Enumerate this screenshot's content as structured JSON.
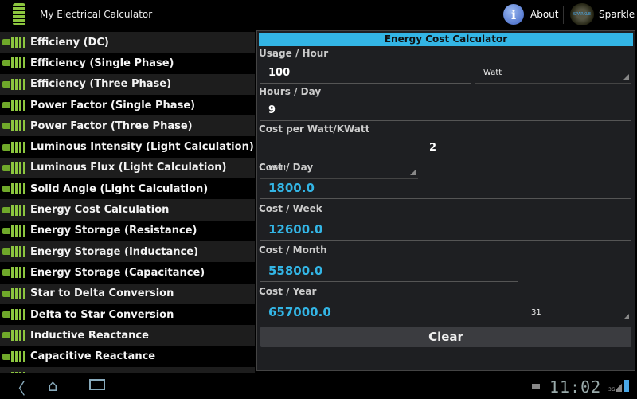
{
  "app": {
    "title": "My Electrical Calculator",
    "about": "About",
    "sparkle": "Sparkle",
    "sparkle_logo_text": "SPARKLE"
  },
  "sidebar": {
    "items": [
      "Efficieny (DC)",
      "Efficiency (Single Phase)",
      "Efficiency (Three Phase)",
      "Power Factor (Single Phase)",
      "Power Factor (Three Phase)",
      "Luminous Intensity (Light Calculation)",
      "Luminous Flux (Light Calculation)",
      "Solid Angle (Light Calculation)",
      "Energy Cost Calculation",
      "Energy Storage (Resistance)",
      "Energy Storage (Inductance)",
      "Energy Storage (Capacitance)",
      "Star to Delta Conversion",
      "Delta to Star Conversion",
      "Inductive Reactance",
      "Capacitive Reactance",
      ""
    ]
  },
  "calc": {
    "title": "Energy Cost Calculator",
    "usage_label": "Usage / Hour",
    "usage_value": "100",
    "usage_unit": "Watt",
    "hours_label": "Hours / Day",
    "hours_value": "9",
    "cost_label": "Cost per Watt/KWatt",
    "cost_unit": "Watt",
    "cost_value": "2",
    "day_label": "Cost / Day",
    "day_value": "1800.0",
    "week_label": "Cost / Week",
    "week_value": "12600.0",
    "month_label": "Cost / Month",
    "month_value": "55800.0",
    "month_days": "31",
    "year_label": "Cost / Year",
    "year_value": "657000.0",
    "clear": "Clear"
  },
  "status": {
    "time": "11:02",
    "network": "3G"
  },
  "colors": {
    "accent": "#33b5e5",
    "bulb": "#8cc63f"
  }
}
